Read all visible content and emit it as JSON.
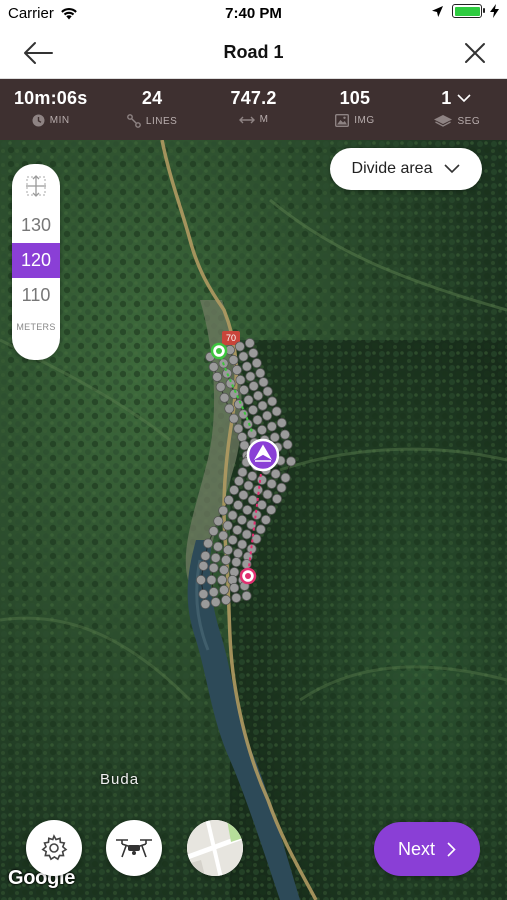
{
  "status_bar": {
    "carrier": "Carrier",
    "time": "7:40 PM"
  },
  "nav": {
    "title": "Road 1"
  },
  "stats": {
    "duration": {
      "value": "10m:06s",
      "unit": "MIN"
    },
    "lines": {
      "value": "24",
      "unit": "LINES"
    },
    "distance": {
      "value": "747.2",
      "unit": "M"
    },
    "images": {
      "value": "105",
      "unit": "IMG"
    },
    "segments": {
      "value": "1",
      "unit": "SEG"
    }
  },
  "map": {
    "divide_area_label": "Divide area",
    "altitude": {
      "options": [
        "130",
        "120",
        "110"
      ],
      "selected": "120",
      "unit": "METERS"
    },
    "place_label": "Buda",
    "road_marker": "70",
    "attribution": "Google"
  },
  "actions": {
    "next_label": "Next"
  },
  "colors": {
    "accent": "#8a3fd6",
    "stats_bg": "#3e3030",
    "start_point": "#3ec43e",
    "end_point": "#e03070"
  },
  "icons": [
    "wifi-icon",
    "location-arrow-icon",
    "battery-icon",
    "charging-bolt-icon",
    "back-arrow-icon",
    "close-icon",
    "clock-icon",
    "lines-icon",
    "distance-icon",
    "image-icon",
    "layers-icon",
    "chevron-down-icon",
    "move-handle-icon",
    "settings-icon",
    "drone-icon",
    "map-type-icon",
    "chevron-right-icon",
    "drone-position-icon"
  ]
}
